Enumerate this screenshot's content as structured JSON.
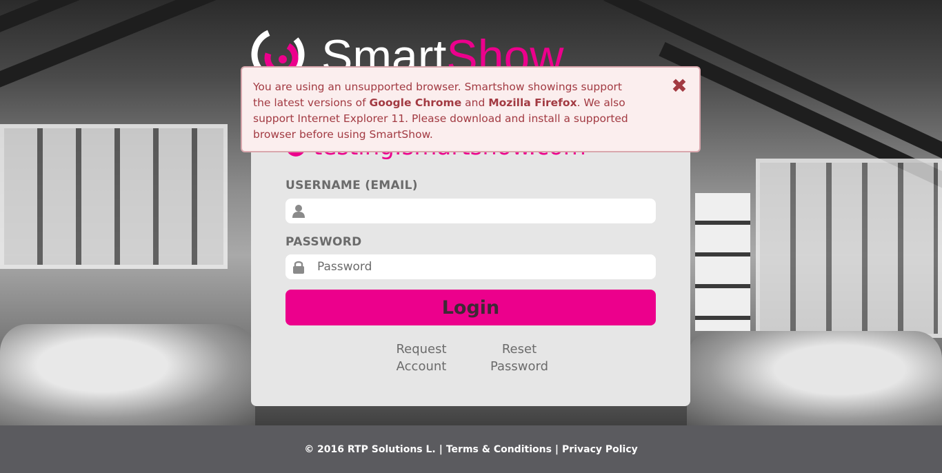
{
  "brand": {
    "logo_text_main": "Smart",
    "logo_text_accent": "Show",
    "accent_color": "#ec008c"
  },
  "alert": {
    "line1": "You are using an unsupported browser. Smartshow showings support",
    "line2_pre": "the latest versions of ",
    "line2_b1": "Google Chrome",
    "line2_mid": " and ",
    "line2_b2": "Mozilla Firefox",
    "line2_post": ". We also",
    "line3": "support Internet Explorer 11. Please download and install a supported",
    "line4": "browser before using SmartShow.",
    "close_icon": "close-x-icon"
  },
  "site": {
    "icon": "globe-icon",
    "domain": "testing.smartshow.com"
  },
  "form": {
    "username_label": "USERNAME (EMAIL)",
    "username_value": "",
    "username_placeholder": "",
    "username_icon": "user-icon",
    "password_label": "PASSWORD",
    "password_placeholder": "Password",
    "password_icon": "lock-icon",
    "login_label": "Login",
    "request_account_line1": "Request",
    "request_account_line2": "Account",
    "reset_password_line1": "Reset",
    "reset_password_line2": "Password"
  },
  "footer": {
    "copyright": "© 2016 RTP Solutions L.",
    "separator": "|",
    "terms": "Terms & Conditions",
    "privacy": "Privacy Policy"
  }
}
